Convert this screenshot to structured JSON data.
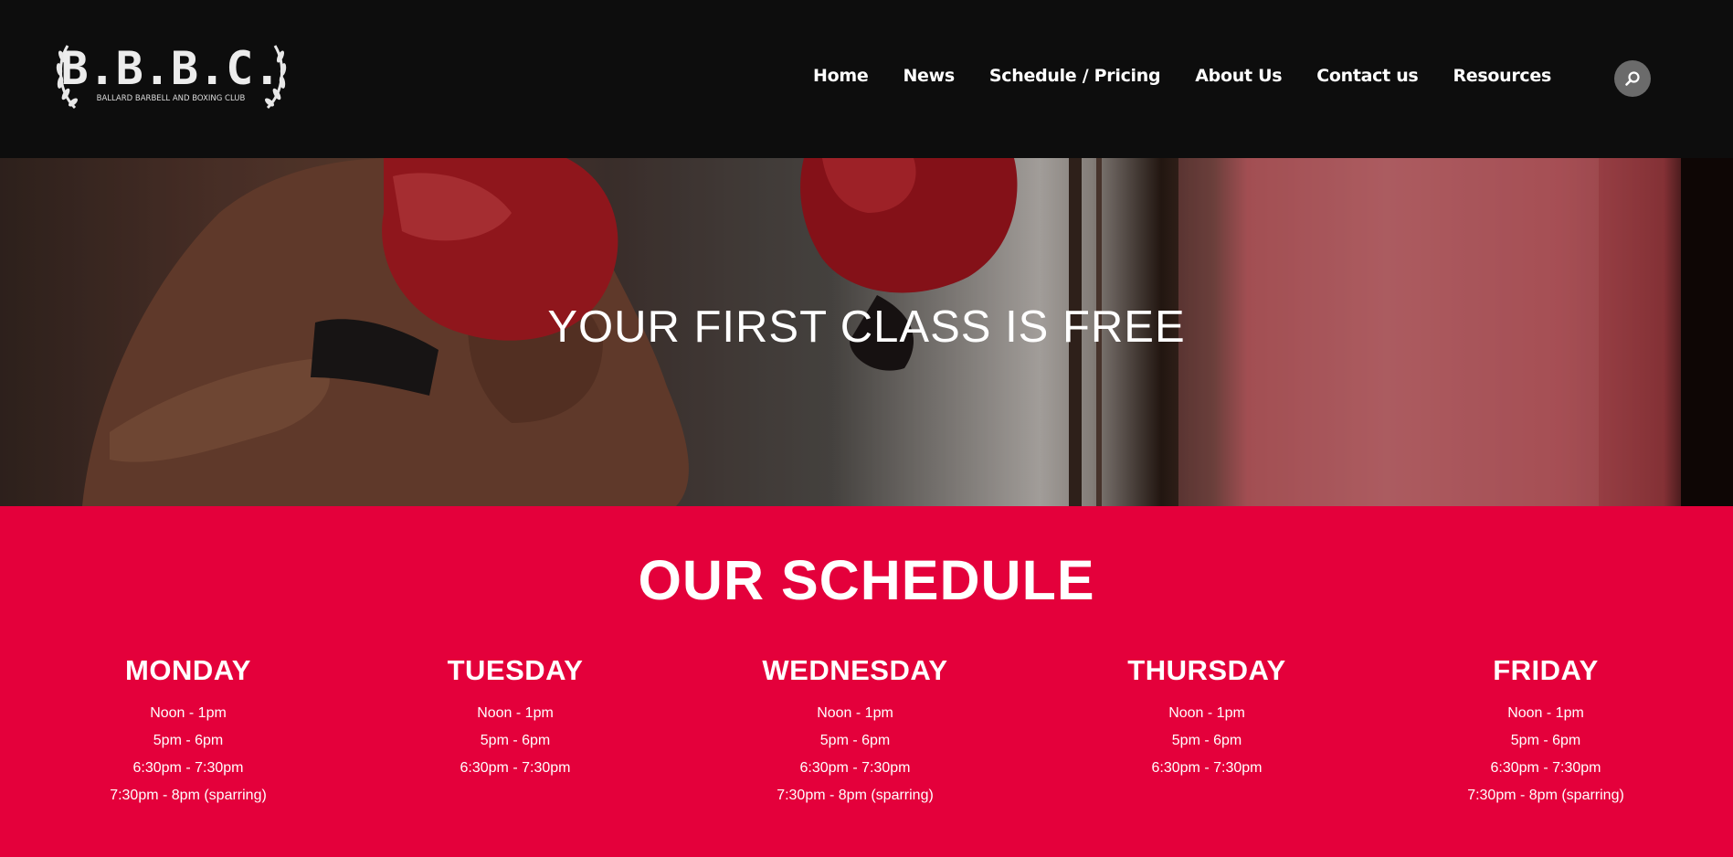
{
  "header": {
    "logo_text": "B.B.B.C.",
    "logo_subtext": "BALLARD BARBELL AND BOXING CLUB",
    "nav": [
      {
        "label": "Home"
      },
      {
        "label": "News"
      },
      {
        "label": "Schedule / Pricing"
      },
      {
        "label": "About Us"
      },
      {
        "label": "Contact us"
      },
      {
        "label": "Resources"
      }
    ],
    "search_icon": "search-icon"
  },
  "hero": {
    "title": "YOUR FIRST CLASS IS FREE"
  },
  "schedule": {
    "title": "OUR SCHEDULE",
    "days": [
      {
        "name": "MONDAY",
        "slots": [
          "Noon - 1pm",
          "5pm - 6pm",
          "6:30pm - 7:30pm",
          "7:30pm - 8pm (sparring)"
        ]
      },
      {
        "name": "TUESDAY",
        "slots": [
          "Noon - 1pm",
          "5pm - 6pm",
          "6:30pm - 7:30pm"
        ]
      },
      {
        "name": "WEDNESDAY",
        "slots": [
          "Noon - 1pm",
          "5pm - 6pm",
          "6:30pm - 7:30pm",
          "7:30pm - 8pm (sparring)"
        ]
      },
      {
        "name": "THURSDAY",
        "slots": [
          "Noon - 1pm",
          "5pm - 6pm",
          "6:30pm - 7:30pm"
        ]
      },
      {
        "name": "FRIDAY",
        "slots": [
          "Noon - 1pm",
          "5pm - 6pm",
          "6:30pm - 7:30pm",
          "7:30pm - 8pm (sparring)"
        ]
      }
    ]
  },
  "colors": {
    "header_bg": "#0d0d0d",
    "accent_red": "#e4003b",
    "search_bg": "#6b6b6b"
  }
}
